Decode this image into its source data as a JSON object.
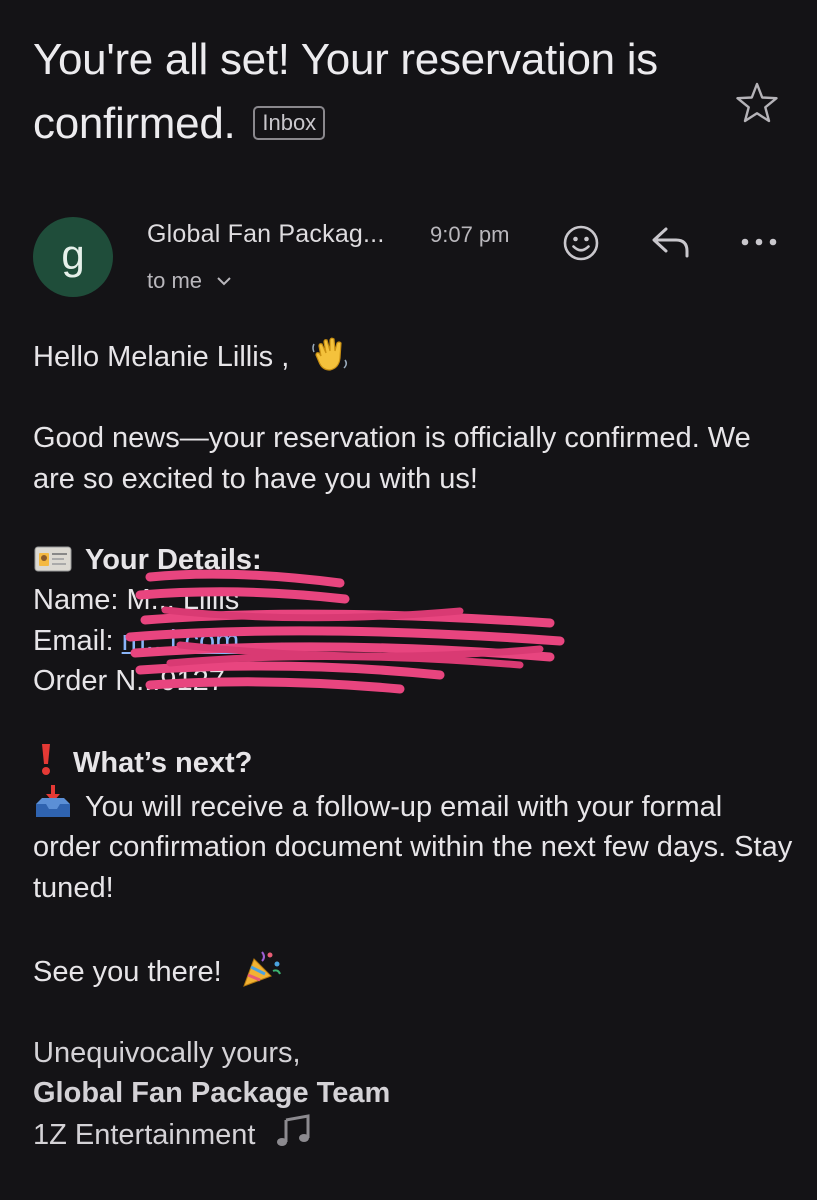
{
  "subject": {
    "title": "You're all set! Your reservation is confirmed.",
    "label_badge": "Inbox"
  },
  "message": {
    "avatar_letter": "g",
    "sender": "Global Fan Packag...",
    "time": "9:07 pm",
    "recipient": "to me"
  },
  "body": {
    "greeting": "Hello Melanie Lillis ,",
    "intro": "Good news—your reservation is officially confirmed. We are so excited to have you with us!",
    "details_heading": "Your Details:",
    "name_label": "Name:",
    "name_value": "M...  Lillis",
    "email_label": "Email:",
    "email_value": "m...l.com",
    "order_label": "Order",
    "order_value": "N...9127",
    "next_heading": "What’s next?",
    "next_text": "You will receive a follow-up email with your formal order confirmation document within the next few days. Stay tuned!",
    "see_you": "See you there!",
    "signoff": "Unequivocally yours,",
    "team": "Global Fan Package Team",
    "company": "1Z Entertainment"
  },
  "icons": {
    "star": "star-icon",
    "emoji_reaction": "smiley-icon",
    "reply": "reply-icon",
    "more": "more-icon",
    "expand": "chevron-down-icon"
  },
  "colors": {
    "background": "#141316",
    "avatar": "#1f4d3a",
    "link": "#8ab4f8",
    "redaction": "#e8457f"
  }
}
